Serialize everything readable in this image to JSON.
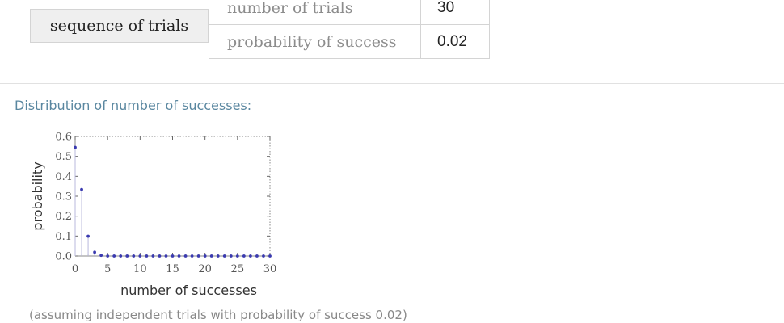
{
  "input": {
    "header": "sequence of trials",
    "params": [
      {
        "label": "number of trials",
        "value": "30"
      },
      {
        "label": "probability of success",
        "value": "0.02"
      }
    ]
  },
  "section": {
    "title": "Distribution of number of successes:"
  },
  "footnote": "(assuming independent trials with probability of success 0.02)",
  "colors": {
    "point": "#3a3ab0",
    "stem": "#b8b8dc",
    "frame": "#888888",
    "section_title": "#5a87a0"
  },
  "chart_data": {
    "type": "scatter",
    "title": "",
    "xlabel": "number of successes",
    "ylabel": "probability",
    "xlim": [
      0,
      30
    ],
    "ylim": [
      0,
      0.6
    ],
    "grid": false,
    "legend": "none",
    "xticks": [
      0,
      5,
      10,
      15,
      20,
      25,
      30
    ],
    "xtick_labels": [
      "0",
      "5",
      "10",
      "15",
      "20",
      "25",
      "30"
    ],
    "yticks": [
      0,
      0.1,
      0.2,
      0.3,
      0.4,
      0.5,
      0.6
    ],
    "ytick_labels": [
      "0.0",
      "0.1",
      "0.2",
      "0.3",
      "0.4",
      "0.5",
      "0.6"
    ],
    "series": [
      {
        "x": [
          0,
          1,
          2,
          3,
          4,
          5,
          6,
          7,
          8,
          9,
          10,
          11,
          12,
          13,
          14,
          15,
          16,
          17,
          18,
          19,
          20,
          21,
          22,
          23,
          24,
          25,
          26,
          27,
          28,
          29,
          30
        ],
        "values": [
          0.545,
          0.334,
          0.099,
          0.019,
          0.003,
          0,
          0,
          0,
          0,
          0,
          0,
          0,
          0,
          0,
          0,
          0,
          0,
          0,
          0,
          0,
          0,
          0,
          0,
          0,
          0,
          0,
          0,
          0,
          0,
          0,
          0
        ]
      }
    ]
  }
}
